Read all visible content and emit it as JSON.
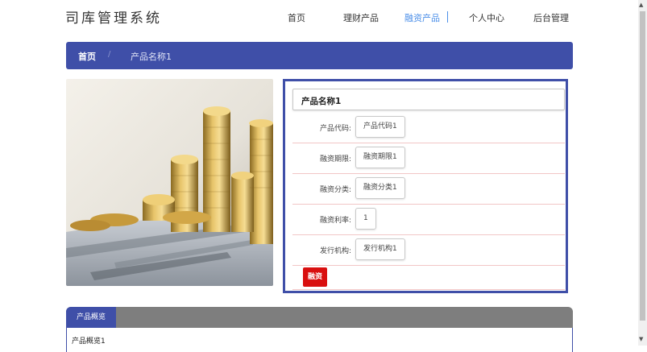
{
  "header": {
    "logo": "司库管理系统",
    "nav": [
      {
        "label": "首页",
        "active": false
      },
      {
        "label": "理财产品",
        "active": false
      },
      {
        "label": "融资产品",
        "active": true
      },
      {
        "label": "个人中心",
        "active": false
      },
      {
        "label": "后台管理",
        "active": false
      }
    ]
  },
  "breadcrumb": {
    "home": "首页",
    "separator": "/",
    "current": "产品名称1"
  },
  "product": {
    "name": "产品名称1",
    "fields": [
      {
        "label": "产品代码:",
        "value": "产品代码1"
      },
      {
        "label": "融资期限:",
        "value": "融资期限1"
      },
      {
        "label": "融资分类:",
        "value": "融资分类1"
      },
      {
        "label": "融资利率:",
        "value": "1"
      },
      {
        "label": "发行机构:",
        "value": "发行机构1"
      }
    ],
    "action_label": "融资"
  },
  "overview": {
    "tab_label": "产品概览",
    "content": "产品概览1"
  },
  "colors": {
    "primary": "#3f4fa8",
    "active_nav": "#4a8ee8",
    "action": "#d90f0f",
    "divider": "#f2c6c6"
  }
}
